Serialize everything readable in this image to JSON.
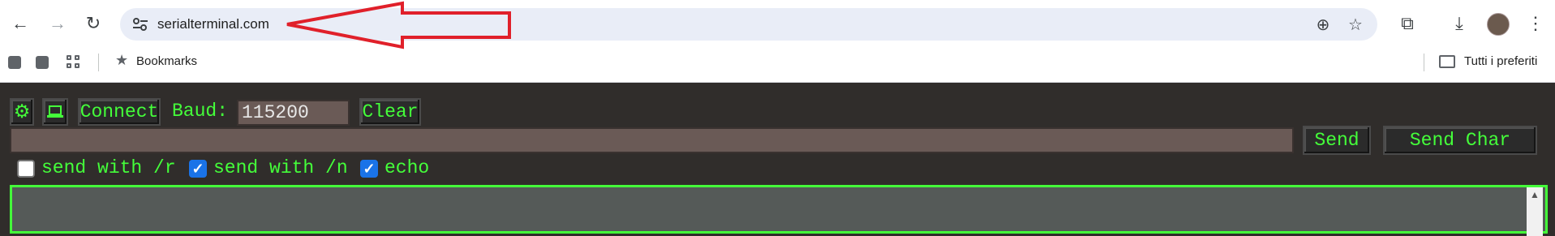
{
  "browser": {
    "url": "serialterminal.com",
    "bookmarks_label": "Bookmarks",
    "all_bookmarks_label": "Tutti i preferiti"
  },
  "icons": {
    "back": "←",
    "forward": "→",
    "reload": "↻",
    "zoom": "⊕",
    "star": "☆",
    "extensions": "⧉",
    "download": "⤓",
    "menu": "⋮",
    "bookmark_star": "★",
    "settings": "⚙",
    "port": "💻"
  },
  "annotation": {
    "arrow_color": "#e0202a"
  },
  "terminal": {
    "connect_label": "Connect",
    "baud_label": "Baud:",
    "baud_value": "115200",
    "clear_label": "Clear",
    "send_label": "Send",
    "send_char_label": "Send Char",
    "send_value": "",
    "options": [
      {
        "label": "send with /r",
        "checked": false
      },
      {
        "label": "send with /n",
        "checked": true
      },
      {
        "label": "echo",
        "checked": true
      }
    ],
    "accent_color": "#44ff3a"
  }
}
